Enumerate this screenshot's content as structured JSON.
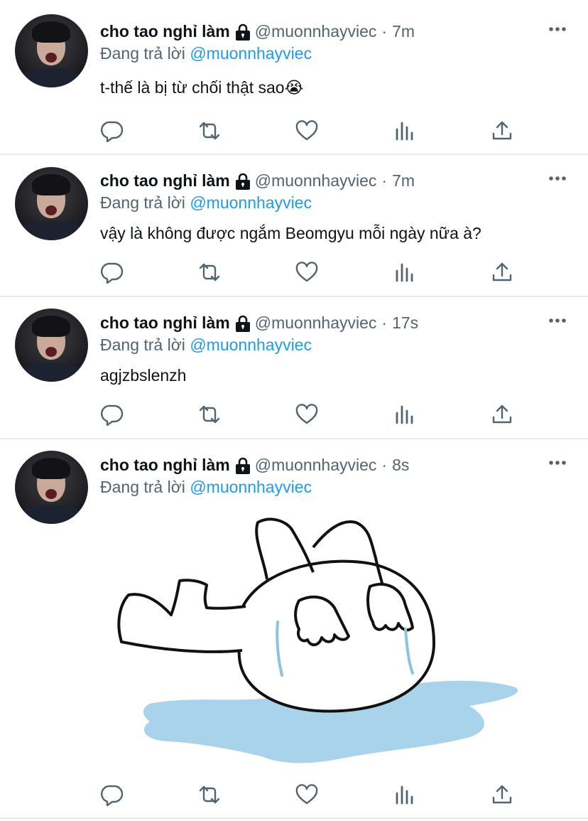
{
  "tweets": [
    {
      "name": "cho tao nghỉ làm",
      "handle": "@muonnhayviec",
      "separator": "·",
      "time": "7m",
      "reply_prefix": "Đang trả lời",
      "reply_to": "@muonnhayviec",
      "text": "t-thế là bị từ chối thật sao😭"
    },
    {
      "name": "cho tao nghỉ làm",
      "handle": "@muonnhayviec",
      "separator": "·",
      "time": "7m",
      "reply_prefix": "Đang trả lời",
      "reply_to": "@muonnhayviec",
      "text": "vậy là không được ngắm Beomgyu mỗi ngày nữa à?"
    },
    {
      "name": "cho tao nghỉ làm",
      "handle": "@muonnhayviec",
      "separator": "·",
      "time": "17s",
      "reply_prefix": "Đang trả lời",
      "reply_to": "@muonnhayviec",
      "text": "agjzbslenzh"
    },
    {
      "name": "cho tao nghỉ làm",
      "handle": "@muonnhayviec",
      "separator": "·",
      "time": "8s",
      "reply_prefix": "Đang trả lời",
      "reply_to": "@muonnhayviec",
      "text": ""
    }
  ],
  "colors": {
    "link": "#1d9bf0",
    "secondary": "#536471",
    "icon": "#536471",
    "divider": "#e6ecf0",
    "puddle": "#a9d3ea"
  },
  "icons": [
    "lock-icon",
    "more-icon",
    "reply-icon",
    "retweet-icon",
    "like-icon",
    "stats-icon",
    "share-icon"
  ]
}
